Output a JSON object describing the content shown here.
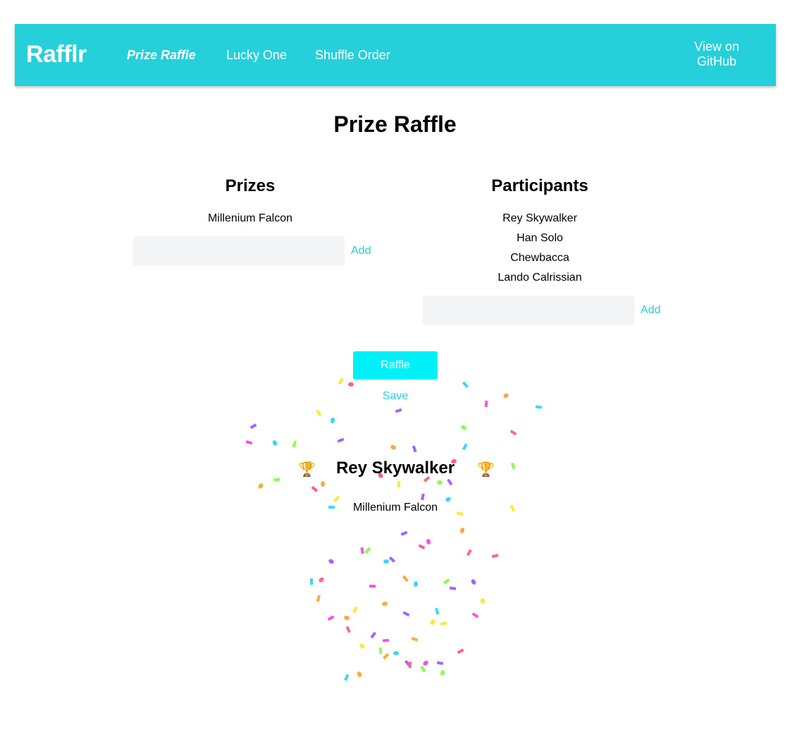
{
  "navbar": {
    "brand": "Rafflr",
    "links": [
      {
        "label": "Prize Raffle",
        "active": true
      },
      {
        "label": "Lucky One",
        "active": false
      },
      {
        "label": "Shuffle Order",
        "active": false
      }
    ],
    "github_label": "View on GitHub"
  },
  "page": {
    "title": "Prize Raffle"
  },
  "prizes": {
    "title": "Prizes",
    "items": [
      "Millenium Falcon"
    ],
    "input_value": "",
    "add_label": "Add"
  },
  "participants": {
    "title": "Participants",
    "items": [
      "Rey Skywalker",
      "Han Solo",
      "Chewbacca",
      "Lando Calrissian"
    ],
    "input_value": "",
    "add_label": "Add"
  },
  "actions": {
    "raffle_label": "Raffle",
    "save_label": "Save"
  },
  "winner": {
    "name": "Rey Skywalker",
    "prize": "Millenium Falcon",
    "icon": "trophy-icon",
    "trophy_glyph": "🏆"
  },
  "colors": {
    "accent": "#26d0da",
    "button": "#00f0f8",
    "input_bg": "#f3f4f6",
    "confetti": [
      "#ff5c9a",
      "#ffe83a",
      "#3dd5ff",
      "#a463ff",
      "#ffa940",
      "#8bff4a",
      "#ff4fe8",
      "#ff6b81"
    ]
  }
}
